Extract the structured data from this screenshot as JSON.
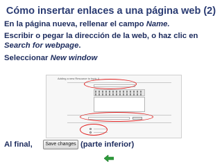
{
  "slide": {
    "title": "Cómo insertar enlaces a una página web (2)",
    "line1_a": "En la página nueva, rellenar el campo ",
    "line1_b": "Name.",
    "line2": "Escribir o pegar la dirección de la web, o haz clic en",
    "line3_a": "Search for webpage",
    "line3_b": ".",
    "line4_a": "Seleccionar ",
    "line4_b": "New window",
    "final_a": "Al final,",
    "final_b": "(parte inferior)"
  },
  "screenshot": {
    "heading": "Adding a new Resource to topic 4",
    "save_button": "Save changes"
  },
  "colors": {
    "title": "#2a3b72",
    "text": "#1b2a5c",
    "highlight_ring": "#e0201f",
    "back_arrow": "#2e9b3b"
  },
  "icons": {
    "back": "green-left-arrow"
  }
}
